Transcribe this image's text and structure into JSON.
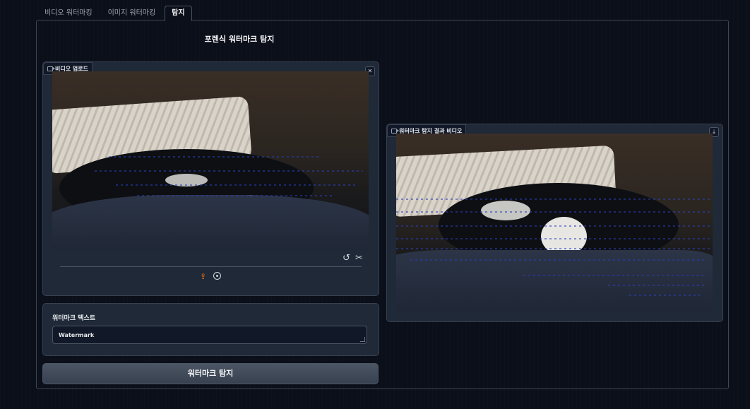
{
  "tabs": [
    {
      "label": "비디오 워터마킹",
      "active": false
    },
    {
      "label": "이미지 워터마킹",
      "active": false
    },
    {
      "label": "탐지",
      "active": true
    }
  ],
  "page_title": "포렌식 워터마크 탐지",
  "upload_panel": {
    "label": "비디오 업로드",
    "close_icon": "close-icon",
    "undo_icon": "undo-icon",
    "trim_icon": "scissors-icon",
    "upload_icon": "upload-icon",
    "webcam_icon": "webcam-icon"
  },
  "result_panel": {
    "label": "워터마크 탐지 결과 비디오",
    "download_icon": "download-icon"
  },
  "watermark_text": {
    "label": "워터마크 텍스트",
    "value": "Watermark"
  },
  "detect_button": {
    "label": "워터마크 탐지"
  },
  "colors": {
    "background": "#0b0f19",
    "panel": "#1f2937",
    "accent": "#f97316"
  }
}
